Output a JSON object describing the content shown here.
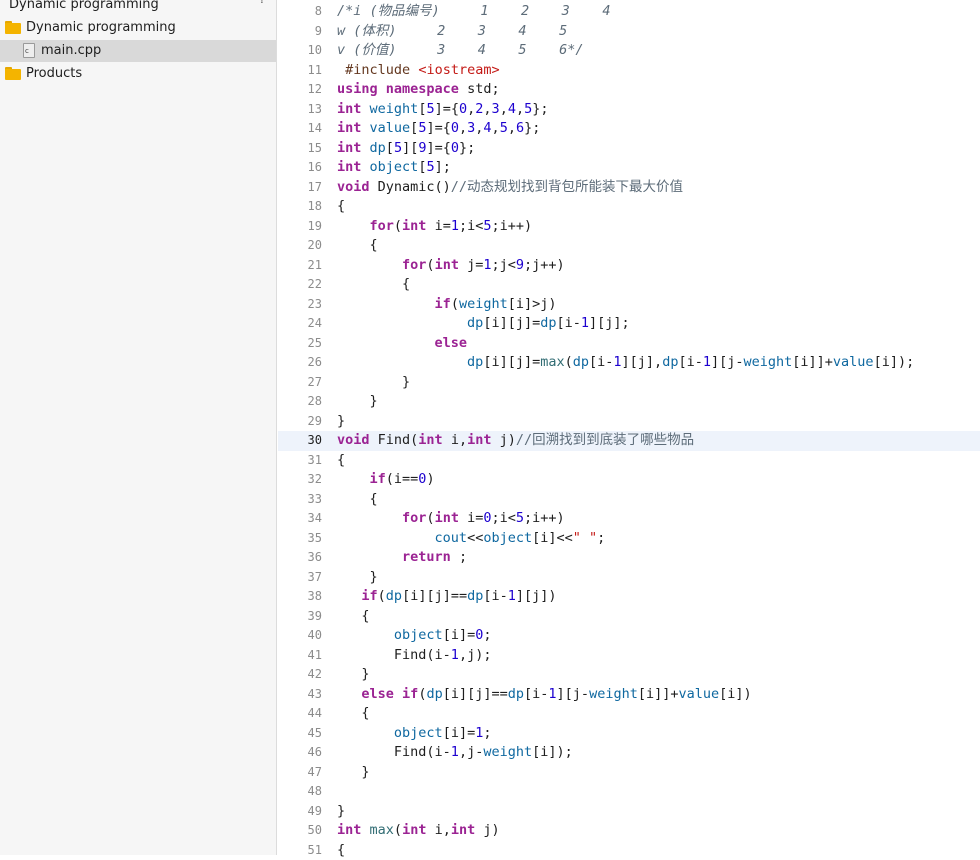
{
  "sidebar": {
    "items": [
      {
        "label": "Dynamic programming",
        "icon": "project-icon"
      },
      {
        "label": "Dynamic programming",
        "icon": "folder-icon"
      },
      {
        "label": "main.cpp",
        "icon": "cpp-file-icon",
        "selected": true
      },
      {
        "label": "Products",
        "icon": "folder-icon"
      }
    ],
    "help_mark": "?"
  },
  "editor": {
    "file": "main.cpp",
    "current_line": 30,
    "lines": [
      {
        "n": "8",
        "t": "/*i (物品编号)     1    2    3    4"
      },
      {
        "n": "9",
        "t": "w (体积)     2    3    4    5"
      },
      {
        "n": "10",
        "t": "v (价值)     3    4    5    6*/"
      },
      {
        "n": "11",
        "t": " #include <iostream>"
      },
      {
        "n": "12",
        "t": "using namespace std;"
      },
      {
        "n": "13",
        "t": "int weight[5]={0,2,3,4,5};"
      },
      {
        "n": "14",
        "t": "int value[5]={0,3,4,5,6};"
      },
      {
        "n": "15",
        "t": "int dp[5][9]={0};"
      },
      {
        "n": "16",
        "t": "int object[5];"
      },
      {
        "n": "17",
        "t": "void Dynamic()//动态规划找到背包所能装下最大价值"
      },
      {
        "n": "18",
        "t": "{"
      },
      {
        "n": "19",
        "t": "    for(int i=1;i<5;i++)"
      },
      {
        "n": "20",
        "t": "    {"
      },
      {
        "n": "21",
        "t": "        for(int j=1;j<9;j++)"
      },
      {
        "n": "22",
        "t": "        {"
      },
      {
        "n": "23",
        "t": "            if(weight[i]>j)"
      },
      {
        "n": "24",
        "t": "                dp[i][j]=dp[i-1][j];"
      },
      {
        "n": "25",
        "t": "            else"
      },
      {
        "n": "26",
        "t": "                dp[i][j]=max(dp[i-1][j],dp[i-1][j-weight[i]]+value[i]);"
      },
      {
        "n": "27",
        "t": "        }"
      },
      {
        "n": "28",
        "t": "    }"
      },
      {
        "n": "29",
        "t": "}"
      },
      {
        "n": "30",
        "t": "void Find(int i,int j)//回溯找到到底装了哪些物品"
      },
      {
        "n": "31",
        "t": "{"
      },
      {
        "n": "32",
        "t": "    if(i==0)"
      },
      {
        "n": "33",
        "t": "    {"
      },
      {
        "n": "34",
        "t": "        for(int i=0;i<5;i++)"
      },
      {
        "n": "35",
        "t": "            cout<<object[i]<<\" \";"
      },
      {
        "n": "36",
        "t": "        return ;"
      },
      {
        "n": "37",
        "t": "    }"
      },
      {
        "n": "38",
        "t": "   if(dp[i][j]==dp[i-1][j])"
      },
      {
        "n": "39",
        "t": "   {"
      },
      {
        "n": "40",
        "t": "       object[i]=0;"
      },
      {
        "n": "41",
        "t": "       Find(i-1,j);"
      },
      {
        "n": "42",
        "t": "   }"
      },
      {
        "n": "43",
        "t": "   else if(dp[i][j]==dp[i-1][j-weight[i]]+value[i])"
      },
      {
        "n": "44",
        "t": "   {"
      },
      {
        "n": "45",
        "t": "       object[i]=1;"
      },
      {
        "n": "46",
        "t": "       Find(i-1,j-weight[i]);"
      },
      {
        "n": "47",
        "t": "   }"
      },
      {
        "n": "48",
        "t": ""
      },
      {
        "n": "49",
        "t": "}"
      },
      {
        "n": "50",
        "t": "int max(int i,int j)"
      },
      {
        "n": "51",
        "t": "{"
      }
    ]
  },
  "colors": {
    "keyword": "#9b2393",
    "number": "#1c00cf",
    "string": "#c41a16",
    "preprocessor": "#643820",
    "comment": "#5d6c79",
    "variable": "#0f68a0",
    "current_line_bg": "#eef3fb",
    "sidebar_selected_bg": "#d9d9d9"
  }
}
